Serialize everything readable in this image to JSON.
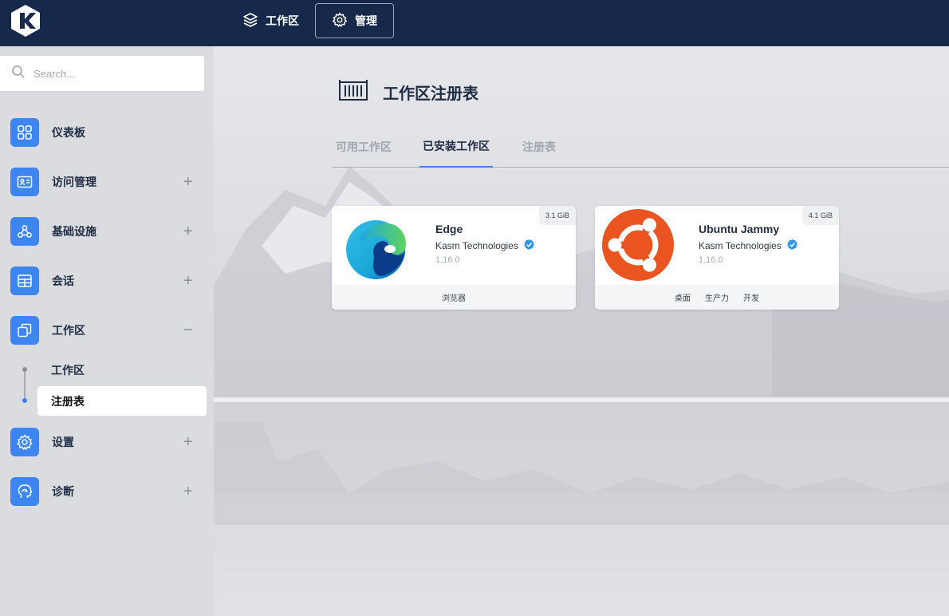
{
  "topbar": {
    "nav": [
      {
        "label": "工作区",
        "icon": "layers-icon"
      },
      {
        "label": "管理",
        "icon": "gear-icon"
      }
    ]
  },
  "sidebar": {
    "search_placeholder": "Search...",
    "items": [
      {
        "label": "仪表板",
        "icon": "grid-icon",
        "expand": ""
      },
      {
        "label": "访问管理",
        "icon": "id-card-icon",
        "expand": "+"
      },
      {
        "label": "基础设施",
        "icon": "webhook-icon",
        "expand": "+"
      },
      {
        "label": "会话",
        "icon": "table-icon",
        "expand": "+"
      },
      {
        "label": "工作区",
        "icon": "windows-icon",
        "expand": "−"
      },
      {
        "label": "设置",
        "icon": "gear-icon",
        "expand": "+"
      },
      {
        "label": "诊断",
        "icon": "head-gauge-icon",
        "expand": "+"
      }
    ],
    "subitems": [
      {
        "label": "工作区",
        "active": false
      },
      {
        "label": "注册表",
        "active": true
      }
    ]
  },
  "main": {
    "title": "工作区注册表",
    "tabs": [
      {
        "label": "可用工作区",
        "active": false
      },
      {
        "label": "已安装工作区",
        "active": true
      },
      {
        "label": "注册表",
        "active": false
      }
    ],
    "cards": [
      {
        "name": "Edge",
        "vendor": "Kasm Technologies",
        "version": "1.16.0",
        "size": "3.1 GiB",
        "tags": [
          "浏览器"
        ],
        "logo": "edge-logo-icon"
      },
      {
        "name": "Ubuntu Jammy",
        "vendor": "Kasm Technologies",
        "version": "1.16.0",
        "size": "4.1 GiB",
        "tags": [
          "桌面",
          "生产力",
          "开发"
        ],
        "logo": "ubuntu-logo-icon"
      }
    ]
  },
  "colors": {
    "topbar": "#17294a",
    "accent": "#3d85f0",
    "ubuntu": "#e95420"
  }
}
